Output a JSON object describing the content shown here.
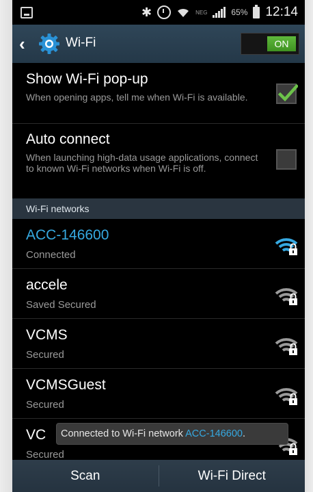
{
  "statusbar": {
    "signal_label": "NEG",
    "battery_percent": "65%",
    "time": "12:14",
    "icons": [
      "notification-icon",
      "bluetooth-icon",
      "alarm-icon",
      "wifi-icon",
      "signal-icon",
      "battery-icon"
    ]
  },
  "actionbar": {
    "title": "Wi-Fi",
    "toggle_label": "ON",
    "toggle_on": true
  },
  "settings": [
    {
      "title": "Show Wi-Fi pop-up",
      "description": "When opening apps, tell me when Wi-Fi is available.",
      "checked": true
    },
    {
      "title": "Auto connect",
      "description": "When launching high-data usage applications, connect to known Wi-Fi networks when Wi-Fi is off.",
      "checked": false
    }
  ],
  "networks_header": "Wi-Fi networks",
  "networks": [
    {
      "name": "ACC-146600",
      "status": "Connected",
      "active": true
    },
    {
      "name": "accele",
      "status": "Saved Secured",
      "active": false
    },
    {
      "name": "VCMS",
      "status": "Secured",
      "active": false
    },
    {
      "name": "VCMSGuest",
      "status": "Secured",
      "active": false
    },
    {
      "name": "VC",
      "status": "Secured",
      "active": false
    }
  ],
  "toast": {
    "prefix": "Connected to Wi-Fi network ",
    "network": "ACC-146600",
    "suffix": "."
  },
  "bottombar": {
    "scan_label": "Scan",
    "direct_label": "Wi-Fi Direct"
  },
  "colors": {
    "accent": "#36a9e1",
    "toggle_on": "#4fa82e",
    "check": "#6cc24a",
    "actionbar": "#2a4052"
  }
}
